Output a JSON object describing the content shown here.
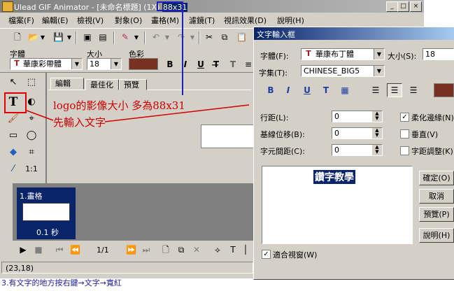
{
  "app": {
    "title_prefix": "Ulead GIF Animator - [未命名標題] (1X)",
    "title_size": "88x31",
    "win_buttons": [
      "_",
      "□",
      "×"
    ]
  },
  "menu": [
    "檔案(F)",
    "編輯(E)",
    "檢視(V)",
    "對象(O)",
    "畫格(M)",
    "濾鏡(T)",
    "視訊效果(D)",
    "說明(H)"
  ],
  "texttoolbar": {
    "font_label": "字體",
    "size_label": "大小",
    "color_label": "色彩",
    "font_value": "華康彩帶體",
    "size_value": "18",
    "color": "#7a3020",
    "style_buttons": [
      "B",
      "I",
      "U",
      "T̶",
      "T"
    ]
  },
  "tabs": [
    "編輯",
    "最佳化",
    "預覽"
  ],
  "frames": {
    "frame1_label": "1.畫格",
    "frame1_delay": "0.1 秒"
  },
  "playbar": {
    "counter": "1/1"
  },
  "status": {
    "coords": "(23,18)"
  },
  "annotations": {
    "line1": "logo的影像大小  多為88x31",
    "line2": "先輸入文字"
  },
  "caption": "3.有文字的地方按右鍵→文字→寬紅",
  "dialog": {
    "title": "文字輸入框",
    "font_label": "字體(F):",
    "font_value": "華康布丁體",
    "size_label": "大小(S):",
    "size_value": "18",
    "charset_label": "字集(T):",
    "charset_value": "CHINESE_BIG5",
    "line_spacing_label": "行距(L):",
    "line_spacing_value": "0",
    "baseline_label": "基線位移(B):",
    "baseline_value": "0",
    "char_spacing_label": "字元間距(C):",
    "char_spacing_value": "0",
    "antialias_label": "柔化邊緣(N)",
    "vertical_label": "垂直(V)",
    "kerning_label": "字距調整(K)",
    "preview_text": "鑽字教學",
    "ok_label": "確定(O)",
    "cancel_label": "取消",
    "preview_button_label": "預覽(P)",
    "help_label": "說明(H)",
    "fit_window_label": "適合視窗(W)",
    "color": "#7a3020"
  }
}
